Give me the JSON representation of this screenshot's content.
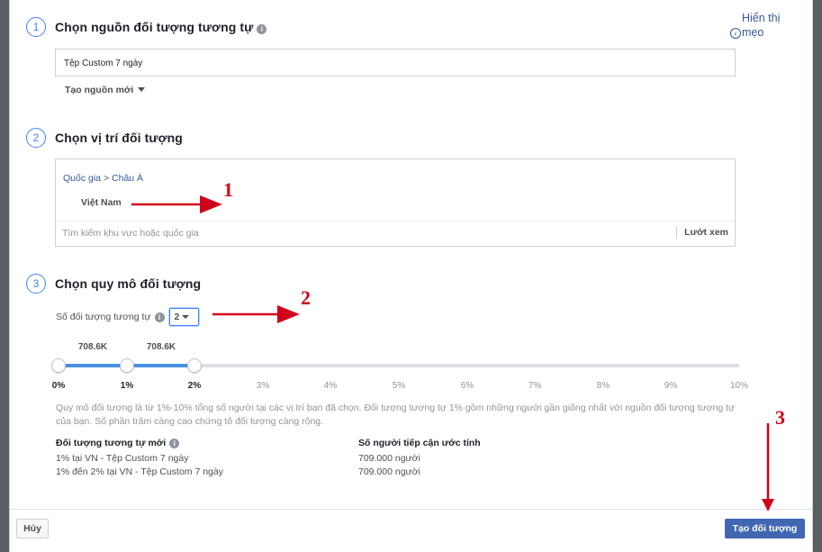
{
  "steps": [
    {
      "num": "1",
      "title": "Chọn nguồn đối tượng tương tự"
    },
    {
      "num": "2",
      "title": "Chọn vị trí đối tượng"
    },
    {
      "num": "3",
      "title": "Chọn quy mô đối tượng"
    }
  ],
  "tips": {
    "label_line1": "Hiển thị",
    "label_line2": "mẹo"
  },
  "source": {
    "value": "Tệp Custom 7 ngày",
    "new_source_label": "Tạo nguồn mới"
  },
  "location": {
    "breadcrumb_country": "Quốc gia",
    "breadcrumb_sep": ">",
    "breadcrumb_region": "Châu Á",
    "selected": "Việt Nam",
    "search_placeholder": "Tìm kiếm khu vực hoặc quốc gia",
    "browse_label": "Lướt xem"
  },
  "audience_size": {
    "count_label": "Số đối tượng tương tự",
    "count_value": "2",
    "ticks": [
      "0%",
      "1%",
      "2%",
      "3%",
      "4%",
      "5%",
      "6%",
      "7%",
      "8%",
      "9%",
      "10%"
    ],
    "selected_percent": [
      0,
      1,
      2
    ],
    "size_labels": [
      "708.6K",
      "708.6K"
    ],
    "description": "Quy mô đối tượng là từ 1%-10% tổng số người tại các vị trí bạn đã chọn. Đối tượng tương tự 1% gồm những người gần giống nhất với nguồn đối tượng tương tự của bạn. Số phần trăm càng cao chứng tỏ đối tượng càng rộng."
  },
  "table": {
    "header_audience": "Đối tượng tương tự mới",
    "header_reach": "Số người tiếp cận ước tính",
    "rows": [
      {
        "audience": "1% tại VN - Tệp Custom 7 ngày",
        "reach": "709.000 người"
      },
      {
        "audience": "1% đến 2% tại VN - Tệp Custom 7 ngày",
        "reach": "709.000 người"
      }
    ]
  },
  "footer": {
    "cancel_label": "Hủy",
    "create_label": "Tạo đối tượng"
  },
  "annotations": {
    "one": "1",
    "two": "2",
    "three": "3"
  },
  "colors": {
    "accent": "#4080ff",
    "primary_button": "#4267b2",
    "annotation": "#d0021b",
    "slider_fill": "#4a90e2"
  }
}
